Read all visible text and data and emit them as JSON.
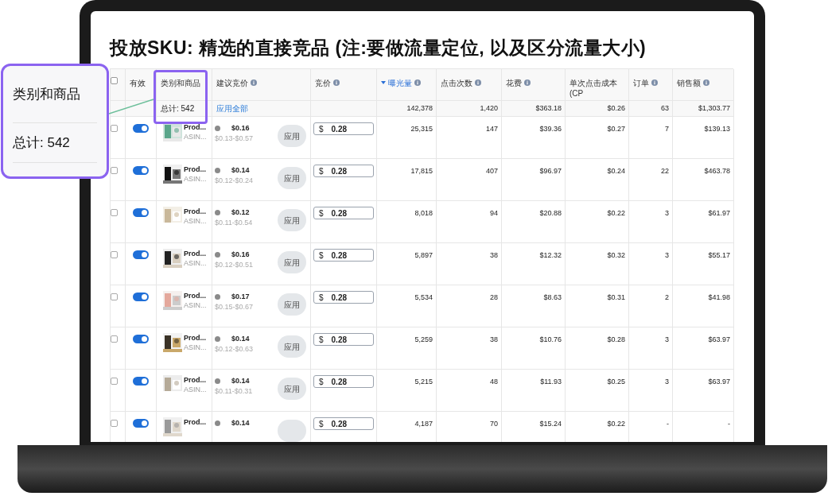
{
  "title": "投放SKU: 精选的直接竞品 (注:要做流量定位, 以及区分流量大小)",
  "select_all": {
    "checked": false
  },
  "callout": {
    "label": "类别和商品",
    "total": "总计: 542"
  },
  "columns": [
    {
      "label": "有效",
      "info": false,
      "sorted": false
    },
    {
      "label": "类别和商品",
      "info": false,
      "sorted": false
    },
    {
      "label": "建议竞价",
      "info": true,
      "sorted": false
    },
    {
      "label": "竞价",
      "info": true,
      "sorted": false
    },
    {
      "label": "曝光量",
      "info": true,
      "sorted": true
    },
    {
      "label": "点击次数",
      "info": true,
      "sorted": false
    },
    {
      "label": "花费",
      "info": true,
      "sorted": false
    },
    {
      "label": "单次点击成本 (CP",
      "info": false,
      "sorted": false
    },
    {
      "label": "订单",
      "info": true,
      "sorted": false
    },
    {
      "label": "销售额",
      "info": true,
      "sorted": false
    }
  ],
  "totals": {
    "category": "总计: 542",
    "apply_all": "应用全部",
    "metrics": [
      "142,378",
      "1,420",
      "$363.18",
      "$0.26",
      "63",
      "$1,303.77"
    ]
  },
  "rows": [
    {
      "checked": false,
      "enabled": true,
      "name": "Prod...",
      "asin": "ASIN...",
      "suggested": "$0.16",
      "range": "$0.13-$0.57",
      "apply": "应用",
      "currency": "$",
      "bid": "0.28",
      "metrics": [
        "25,315",
        "147",
        "$39.36",
        "$0.27",
        "7",
        "$139.13"
      ]
    },
    {
      "checked": false,
      "enabled": true,
      "name": "Prod...",
      "asin": "ASIN...",
      "suggested": "$0.14",
      "range": "$0.12-$0.24",
      "apply": "应用",
      "currency": "$",
      "bid": "0.28",
      "metrics": [
        "17,815",
        "407",
        "$96.97",
        "$0.24",
        "22",
        "$463.78"
      ]
    },
    {
      "checked": false,
      "enabled": true,
      "name": "Prod...",
      "asin": "ASIN...",
      "suggested": "$0.12",
      "range": "$0.11-$0.54",
      "apply": "应用",
      "currency": "$",
      "bid": "0.28",
      "metrics": [
        "8,018",
        "94",
        "$20.88",
        "$0.22",
        "3",
        "$61.97"
      ]
    },
    {
      "checked": false,
      "enabled": true,
      "name": "Prod...",
      "asin": "ASIN...",
      "suggested": "$0.16",
      "range": "$0.12-$0.51",
      "apply": "应用",
      "currency": "$",
      "bid": "0.28",
      "metrics": [
        "5,897",
        "38",
        "$12.32",
        "$0.32",
        "3",
        "$55.17"
      ]
    },
    {
      "checked": false,
      "enabled": true,
      "name": "Prod...",
      "asin": "ASIN...",
      "suggested": "$0.17",
      "range": "$0.15-$0.67",
      "apply": "应用",
      "currency": "$",
      "bid": "0.28",
      "metrics": [
        "5,534",
        "28",
        "$8.63",
        "$0.31",
        "2",
        "$41.98"
      ]
    },
    {
      "checked": false,
      "enabled": true,
      "name": "Prod...",
      "asin": "ASIN...",
      "suggested": "$0.14",
      "range": "$0.12-$0.63",
      "apply": "应用",
      "currency": "$",
      "bid": "0.28",
      "metrics": [
        "5,259",
        "38",
        "$10.76",
        "$0.28",
        "3",
        "$63.97"
      ]
    },
    {
      "checked": false,
      "enabled": true,
      "name": "Prod...",
      "asin": "ASIN...",
      "suggested": "$0.14",
      "range": "$0.11-$0.31",
      "apply": "应用",
      "currency": "$",
      "bid": "0.28",
      "metrics": [
        "5,215",
        "48",
        "$11.93",
        "$0.25",
        "3",
        "$63.97"
      ]
    },
    {
      "checked": false,
      "enabled": true,
      "name": "Prod...",
      "suggested": "$0.14",
      "currency": "$",
      "bid": "0.28",
      "metrics": [
        "4,187",
        "70",
        "$15.24",
        "$0.22",
        "-",
        "-"
      ]
    }
  ]
}
